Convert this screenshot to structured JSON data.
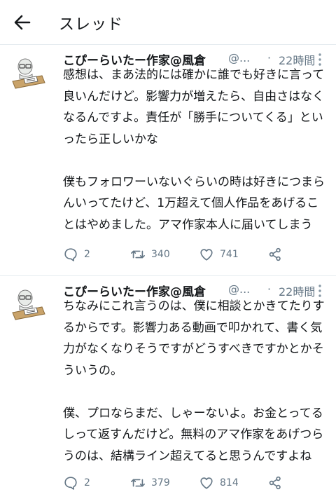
{
  "header": {
    "title": "スレッド"
  },
  "tweets": [
    {
      "name": "こぴーらいたー作家@風倉",
      "handle": "@...",
      "dot": "·",
      "time": "22時間",
      "text": "感想は、まあ法的には確かに誰でも好きに言って良いんだけど。影響力が増えたら、自由さはなくなるんですよ。責任が「勝手についてくる」といったら正しいかな\n\n僕もフォロワーいないぐらいの時は好きにつまらんいってたけど、1万超えて個人作品をあげることはやめました。アマ作家本人に届いてしまう",
      "replies": "2",
      "retweets": "340",
      "likes": "741"
    },
    {
      "name": "こぴーらいたー作家@風倉",
      "handle": "@...",
      "dot": "·",
      "time": "22時間",
      "text": "ちなみにこれ言うのは、僕に相談とかきてたりするからです。影響力ある動画で叩かれて、書く気力がなくなりそうですがどうすべきですかとかそういうの。\n\n僕、プロならまだ、しゃーないよ。お金とってるしって返すんだけど。無料のアマ作家をあげつらうのは、結構ライン超えてると思うんですよね",
      "replies": "2",
      "retweets": "379",
      "likes": "814"
    }
  ],
  "colors": {
    "text": "#14171a",
    "secondary": "#657786",
    "divider": "#e6ecf0"
  },
  "icons": {
    "back": "arrow-left-icon",
    "more": "more-vertical-icon",
    "reply": "comment-icon",
    "retweet": "retweet-icon",
    "like": "heart-icon",
    "share": "share-icon"
  }
}
